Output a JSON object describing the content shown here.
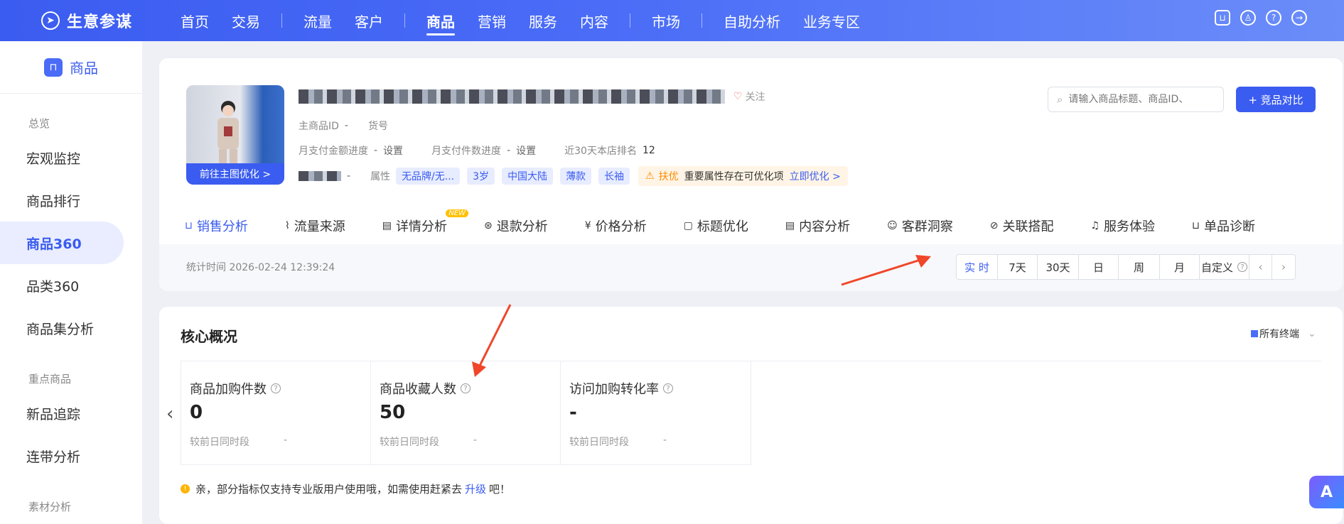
{
  "app": {
    "name": "生意参谋",
    "logo_icon": "compass-icon"
  },
  "topnav": {
    "items": [
      {
        "label": "首页"
      },
      {
        "label": "交易"
      },
      {
        "label": "流量"
      },
      {
        "label": "客户"
      },
      {
        "label": "商品",
        "active": true
      },
      {
        "label": "营销"
      },
      {
        "label": "服务"
      },
      {
        "label": "内容"
      },
      {
        "label": "市场"
      },
      {
        "label": "自助分析"
      },
      {
        "label": "业务专区"
      }
    ],
    "icons": [
      "bag-icon",
      "user-icon",
      "help-icon",
      "logout-icon"
    ]
  },
  "sidebar": {
    "header": "商品",
    "groups": [
      {
        "label": "总览"
      },
      {
        "label": "重点商品"
      },
      {
        "label": "素材分析"
      }
    ],
    "items": [
      {
        "label": "宏观监控"
      },
      {
        "label": "商品排行"
      },
      {
        "label": "商品360",
        "active": true
      },
      {
        "label": "品类360"
      },
      {
        "label": "商品集分析"
      },
      {
        "label": "新品追踪"
      },
      {
        "label": "连带分析"
      }
    ]
  },
  "product": {
    "thumb_button": "前往主图优化 >",
    "follow": "关注",
    "main_id_label": "主商品ID",
    "main_id_value": "-",
    "sku_label": "货号",
    "pay_amount_label": "月支付金额进度",
    "pay_amount_value": "-",
    "pay_amount_link": "设置",
    "pay_count_label": "月支付件数进度",
    "pay_count_value": "-",
    "pay_count_link": "设置",
    "rank_label": "近30天本店排名",
    "rank_value": "12",
    "row4_value": "-",
    "attr_label": "属性",
    "tags": [
      "无品牌/无...",
      "3岁",
      "中国大陆",
      "薄款",
      "长袖"
    ],
    "warn_label": "扶优",
    "warn_text": "重要属性存在可优化项",
    "warn_link": "立即优化 >"
  },
  "search": {
    "placeholder": "请输入商品标题、商品ID、"
  },
  "compare_button": "+ 竞品对比",
  "tabs": [
    {
      "label": "销售分析",
      "icon": "bag-icon",
      "active": true
    },
    {
      "label": "流量来源",
      "icon": "chart-icon"
    },
    {
      "label": "详情分析",
      "icon": "doc-icon",
      "badge": "NEW"
    },
    {
      "label": "退款分析",
      "icon": "refund-icon"
    },
    {
      "label": "价格分析",
      "icon": "price-icon"
    },
    {
      "label": "标题优化",
      "icon": "title-icon"
    },
    {
      "label": "内容分析",
      "icon": "content-icon"
    },
    {
      "label": "客群洞察",
      "icon": "people-icon"
    },
    {
      "label": "关联搭配",
      "icon": "link-icon"
    },
    {
      "label": "服务体验",
      "icon": "headset-icon"
    },
    {
      "label": "单品诊断",
      "icon": "diagnose-icon"
    }
  ],
  "stat_time": "统计时间 2026-02-24 12:39:24",
  "range": {
    "options": [
      "实 时",
      "7天",
      "30天",
      "日",
      "周",
      "月",
      "自定义"
    ],
    "active": "实 时"
  },
  "overview": {
    "title": "核心概况",
    "terminal": "所有终端",
    "metrics": [
      {
        "label": "商品加购件数",
        "value": "0",
        "compare_label": "较前日同时段",
        "compare_value": "-"
      },
      {
        "label": "商品收藏人数",
        "value": "50",
        "compare_label": "较前日同时段",
        "compare_value": "-"
      },
      {
        "label": "访问加购转化率",
        "value": "-",
        "compare_label": "较前日同时段",
        "compare_value": "-"
      }
    ],
    "notice_prefix": "亲，部分指标仅支持专业版用户使用哦，如需使用赶紧去",
    "notice_link": "升级",
    "notice_suffix": "吧！"
  },
  "colors": {
    "primary": "#3b5cf0",
    "annotation_arrow": "#f0462a",
    "warn": "#ff8a00"
  }
}
